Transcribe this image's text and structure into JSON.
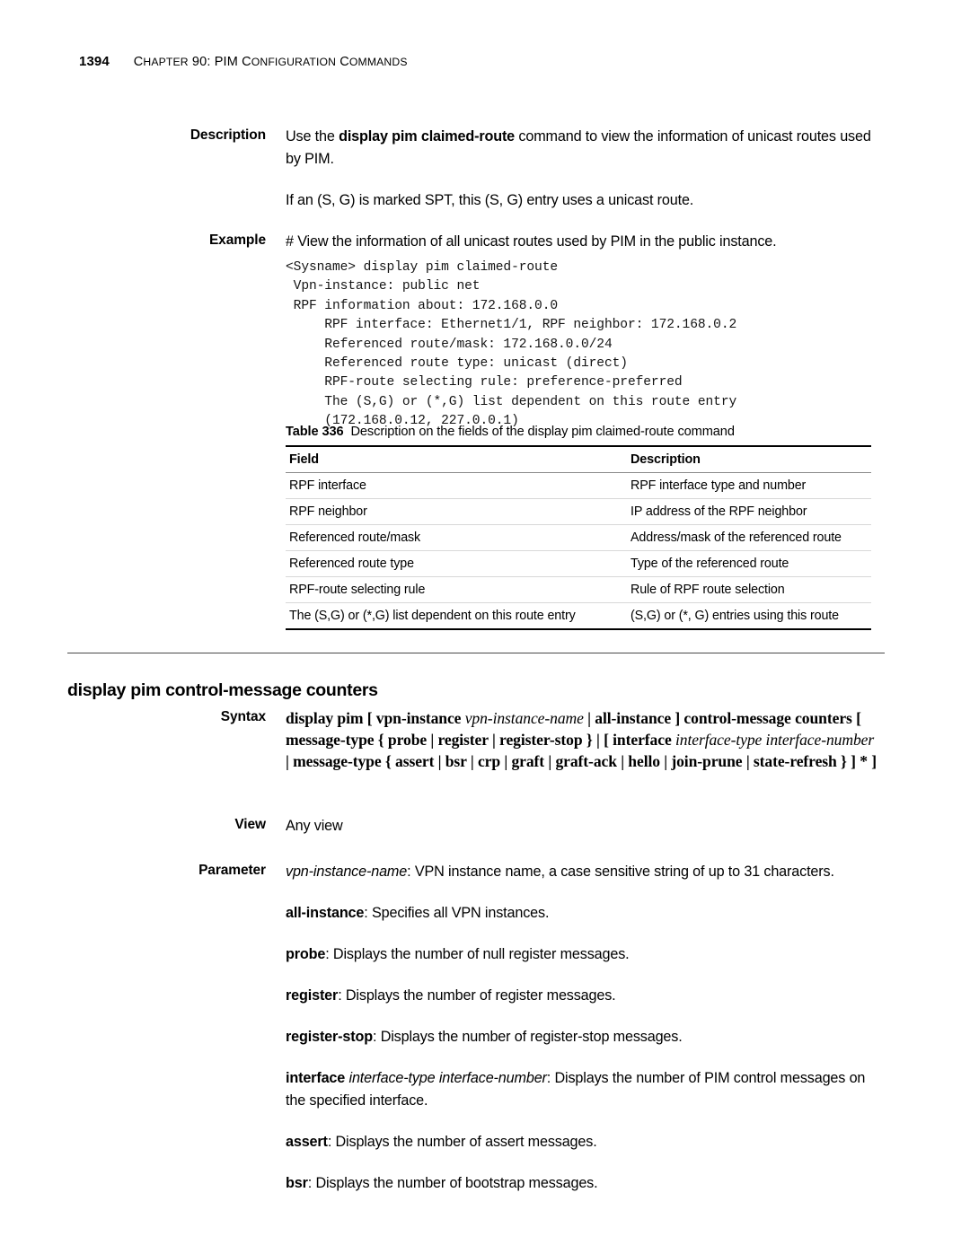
{
  "header": {
    "folio": "1394",
    "chapter_prefix": "C",
    "chapter": "HAPTER",
    "chapter_full": "CHAPTER 90: PIM CONFIGURATION COMMANDS",
    "chapter_parts": {
      "c1": "C",
      "w1": "HAPTER",
      "num": " 90: PIM C",
      "w2": "ONFIGURATION",
      "sp": " C",
      "w3": "OMMANDS"
    }
  },
  "description": {
    "label": "Description",
    "para1_pre": "Use the ",
    "para1_cmd": "display pim claimed-route",
    "para1_post": " command to view the information of unicast routes used by PIM.",
    "para2": "If an (S, G) is marked SPT, this (S, G) entry uses a unicast route."
  },
  "example": {
    "label": "Example",
    "intro": "# View the information of all unicast routes used by PIM in the public instance.",
    "code": "<Sysname> display pim claimed-route\n Vpn-instance: public net\n RPF information about: 172.168.0.0\n     RPF interface: Ethernet1/1, RPF neighbor: 172.168.0.2\n     Referenced route/mask: 172.168.0.0/24\n     Referenced route type: unicast (direct)\n     RPF-route selecting rule: preference-preferred\n     The (S,G) or (*,G) list dependent on this route entry\n     (172.168.0.12, 227.0.0.1)"
  },
  "table": {
    "caption_label": "Table 336",
    "caption_text": "Description on the fields of the display pim claimed-route command",
    "columns": [
      "Field",
      "Description"
    ],
    "rows": [
      [
        "RPF interface",
        "RPF interface type and number"
      ],
      [
        "RPF neighbor",
        "IP address of the RPF neighbor"
      ],
      [
        "Referenced route/mask",
        "Address/mask of the referenced route"
      ],
      [
        "Referenced route type",
        "Type of the referenced route"
      ],
      [
        "RPF-route selecting rule",
        "Rule of RPF route selection"
      ],
      [
        "The (S,G) or (*,G) list dependent on this route entry",
        "(S,G) or (*, G) entries using this route"
      ]
    ]
  },
  "section": {
    "heading": "display pim control-message counters"
  },
  "syntax": {
    "label": "Syntax",
    "line1_a": "display pim",
    "line1_b": " [ ",
    "line1_c": "vpn-instance",
    "line1_d": "vpn-instance-name",
    "line1_e": " | ",
    "line1_f": "all-instance",
    "line1_g": " ] ",
    "line1_h": "control-message",
    "line2_a": "counters",
    "line2_b": " [ ",
    "line2_c": "message-type",
    "line2_d": " { ",
    "line2_e": "probe",
    "line2_f": " | ",
    "line2_g": "register",
    "line2_h": " | ",
    "line2_i": "register-stop",
    "line2_j": " } | [ ",
    "line2_k": "interface",
    "line3_a": "interface-type interface-number",
    "line3_b": " | ",
    "line3_c": "message-type",
    "line3_d": " { ",
    "line3_e": "assert",
    "line3_f": " | ",
    "line3_g": "bsr",
    "line3_h": " | ",
    "line3_i": "crp",
    "line3_j": " | ",
    "line3_k": "graft",
    "line3_l": " | ",
    "line3_m": "graft-ack",
    "line3_n": " | ",
    "line4_a": "hello",
    "line4_b": " | ",
    "line4_c": "join-prune",
    "line4_d": " | ",
    "line4_e": "state-refresh",
    "line4_f": " } ] * ]"
  },
  "view": {
    "label": "View",
    "value": "Any view"
  },
  "parameter": {
    "label": "Parameter",
    "items": [
      {
        "em": "vpn-instance-name",
        "em_style": "italic",
        "text": ": VPN instance name, a case sensitive string of up to 31 characters."
      },
      {
        "em": "all-instance",
        "em_style": "bold",
        "text": ": Specifies all VPN instances."
      },
      {
        "em": "probe",
        "em_style": "bold",
        "text": ": Displays the number of null register messages."
      },
      {
        "em": "register",
        "em_style": "bold",
        "text": ": Displays the number of register messages."
      },
      {
        "em": "register-stop",
        "em_style": "bold",
        "text": ": Displays the number of register-stop messages."
      },
      {
        "em": "interface",
        "em_style": "bold",
        "em2": "interface-type interface-number",
        "text": ": Displays the number of PIM control messages on the specified interface."
      },
      {
        "em": "assert",
        "em_style": "bold",
        "text": ": Displays the number of assert messages."
      },
      {
        "em": "bsr",
        "em_style": "bold",
        "text": ": Displays the number of bootstrap messages."
      }
    ]
  }
}
